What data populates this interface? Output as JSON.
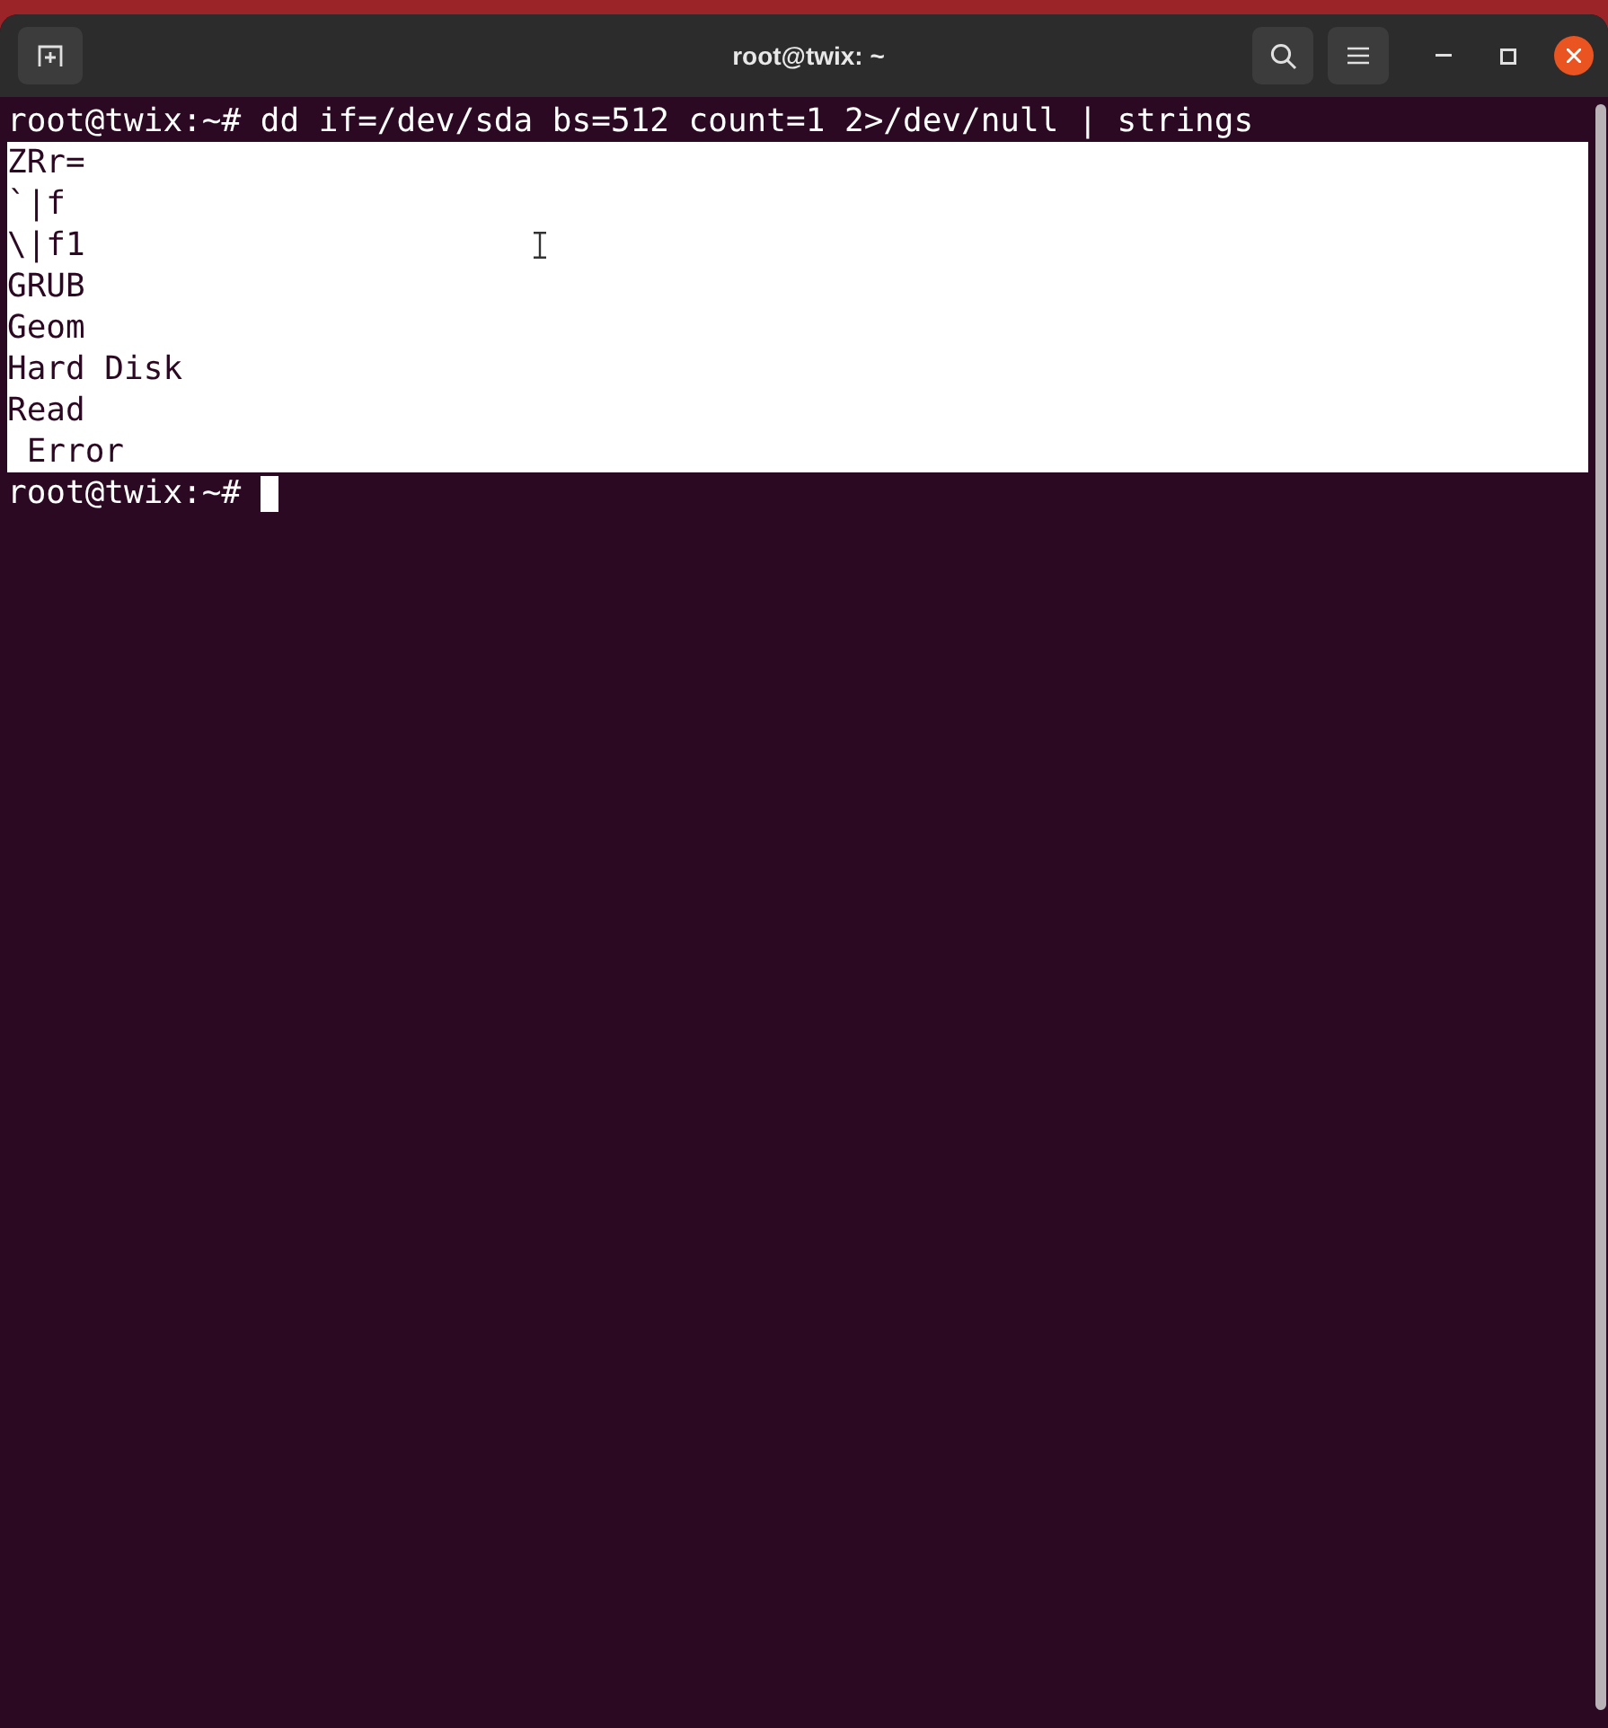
{
  "window": {
    "title": "root@twix: ~"
  },
  "terminal": {
    "lines": [
      {
        "kind": "text",
        "text": "root@twix:~# dd if=/dev/sda bs=512 count=1 2>/dev/null | strings",
        "selected": false
      },
      {
        "kind": "text",
        "text": "ZRr=",
        "selected": true
      },
      {
        "kind": "text",
        "text": "`|f",
        "selected": true
      },
      {
        "kind": "text",
        "text": "\\|f1",
        "selected": true
      },
      {
        "kind": "text",
        "text": "GRUB",
        "selected": true
      },
      {
        "kind": "text",
        "text": "Geom",
        "selected": true
      },
      {
        "kind": "text",
        "text": "Hard Disk",
        "selected": true
      },
      {
        "kind": "text",
        "text": "Read",
        "selected": true
      },
      {
        "kind": "text",
        "text": " Error",
        "selected": true
      },
      {
        "kind": "prompt",
        "text": "root@twix:~#",
        "selected": false,
        "cursor": true
      }
    ]
  }
}
